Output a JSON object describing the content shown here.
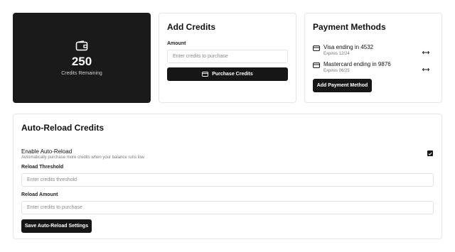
{
  "balance": {
    "icon": "wallet-icon",
    "value": "250",
    "label": "Credits Remaining"
  },
  "add_credits": {
    "title": "Add Credits",
    "amount_label": "Amount",
    "amount_placeholder": "Enter credits to purchase",
    "purchase_label": "Purchase Credits",
    "purchase_icon": "credit-card-icon"
  },
  "payment_methods": {
    "title": "Payment Methods",
    "items": [
      {
        "name": "Visa ending in 4532",
        "expires": "Expires 12/24",
        "icon": "credit-card-icon",
        "action_icon": "swap-arrows-icon"
      },
      {
        "name": "Mastercard ending in 9876",
        "expires": "Expires 06/25",
        "icon": "credit-card-icon",
        "action_icon": "swap-arrows-icon"
      }
    ],
    "add_label": "Add Payment Method"
  },
  "auto_reload": {
    "title": "Auto-Reload Credits",
    "enable_label": "Enable Auto-Reload",
    "enable_desc": "Automatically purchase more credits when your balance runs low.",
    "enabled": true,
    "threshold_label": "Reload Threshold",
    "threshold_placeholder": "Enter credits threshold",
    "amount_label": "Reload Amount",
    "amount_placeholder": "Enter credits to purchase",
    "save_label": "Save Auto-Reload Settings"
  },
  "colors": {
    "primary": "#161616",
    "border": "#e6e6e6",
    "muted_text": "#777777"
  }
}
